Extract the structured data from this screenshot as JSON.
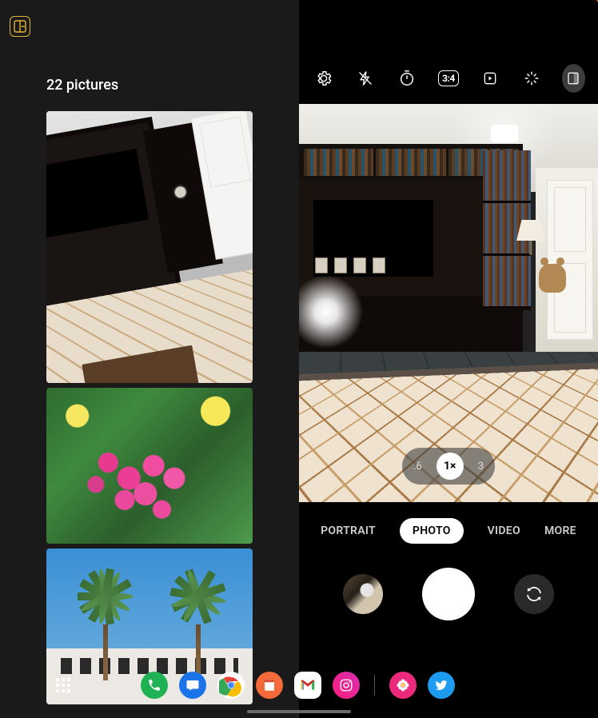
{
  "gallery": {
    "title": "22 pictures",
    "layout_icon": "split-view-icon"
  },
  "camera": {
    "top_icons": {
      "settings": "settings-icon",
      "flash": "flash-off-icon",
      "timer": "timer-icon",
      "ratio": "3:4",
      "motion": "motion-photo-icon",
      "filters": "filters-icon",
      "preview": "cover-preview-icon"
    },
    "zoom": {
      "options": [
        ".6",
        "1×",
        "3"
      ],
      "active": "1×"
    },
    "modes": {
      "items": [
        "PORTRAIT",
        "PHOTO",
        "VIDEO",
        "MORE"
      ],
      "active": "PHOTO"
    },
    "shutter": {
      "thumbnail": "last-shot-thumbnail",
      "capture": "shutter-button",
      "switch": "switch-camera-icon"
    }
  },
  "taskbar": {
    "drawer": "app-drawer-icon",
    "apps": [
      "phone",
      "messages",
      "chrome",
      "calendar",
      "gmail",
      "instagram",
      "gallery",
      "twitter"
    ]
  }
}
